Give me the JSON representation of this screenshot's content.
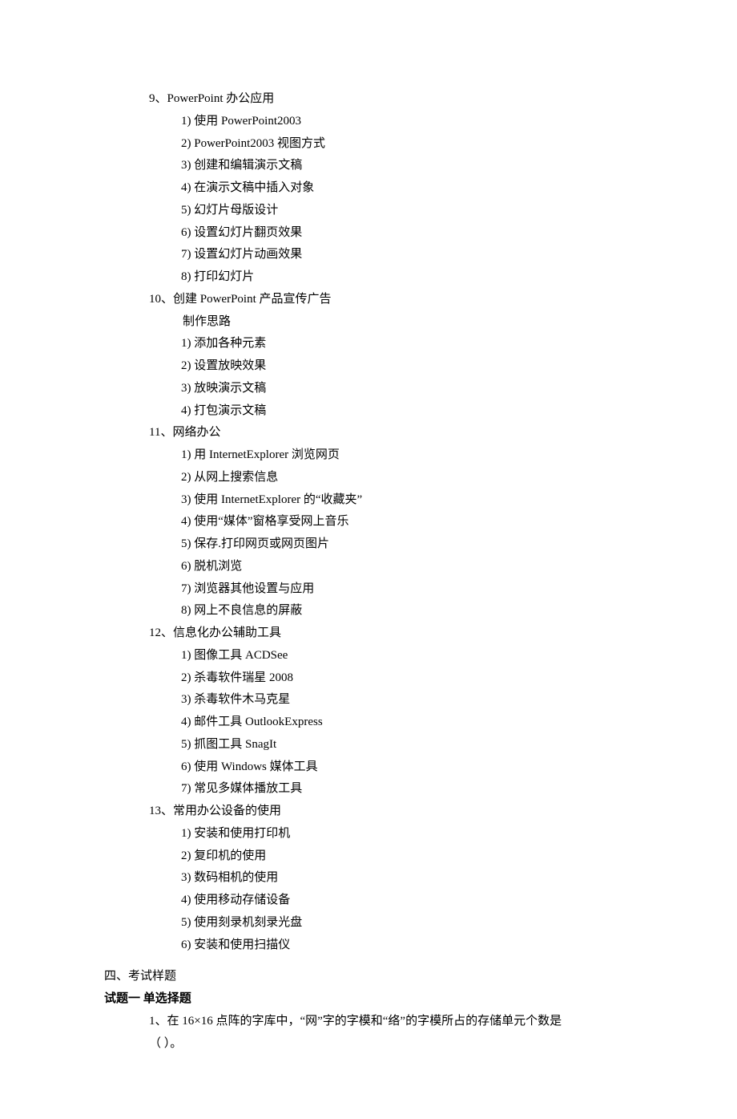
{
  "topics": [
    {
      "num": "9、",
      "title": "PowerPoint 办公应用",
      "prep": null,
      "items": [
        "1)  使用 PowerPoint2003",
        "2)  PowerPoint2003 视图方式",
        "3)  创建和编辑演示文稿",
        "4)  在演示文稿中插入对象",
        "5)  幻灯片母版设计",
        "6)  设置幻灯片翻页效果",
        "7)  设置幻灯片动画效果",
        "8)  打印幻灯片"
      ]
    },
    {
      "num": "10、",
      "title": "创建 PowerPoint 产品宣传广告",
      "prep": "制作思路",
      "items": [
        "1)  添加各种元素",
        "2)  设置放映效果",
        "3)  放映演示文稿",
        "4)  打包演示文稿"
      ]
    },
    {
      "num": "11、",
      "title": "网络办公",
      "prep": null,
      "items": [
        "1)  用 InternetExplorer 浏览网页",
        "2)  从网上搜索信息",
        "3)  使用 InternetExplorer 的“收藏夹”",
        "4)  使用“媒体”窗格享受网上音乐",
        "5)  保存.打印网页或网页图片",
        "6)  脱机浏览",
        "7)  浏览器其他设置与应用",
        "8)  网上不良信息的屏蔽"
      ]
    },
    {
      "num": "12、",
      "title": "信息化办公辅助工具",
      "prep": null,
      "items": [
        "1)  图像工具 ACDSee",
        "2)  杀毒软件瑞星 2008",
        "3)  杀毒软件木马克星",
        "4)  邮件工具 OutlookExpress",
        "5)  抓图工具 SnagIt",
        "6)  使用 Windows 媒体工具",
        "7)  常见多媒体播放工具"
      ]
    },
    {
      "num": "13、",
      "title": "常用办公设备的使用",
      "prep": null,
      "items": [
        "1)  安装和使用打印机",
        "2)  复印机的使用",
        "3)  数码相机的使用",
        "4)  使用移动存储设备",
        "5)  使用刻录机刻录光盘",
        "6)  安装和使用扫描仪"
      ]
    }
  ],
  "section4": "四、考试样题",
  "questionHeader": "试题一    单选择题",
  "q1_line1": "1、在 16×16 点阵的字库中，“网”字的字模和“络”的字模所占的存储单元个数是",
  "q1_line2": "（      ）。"
}
